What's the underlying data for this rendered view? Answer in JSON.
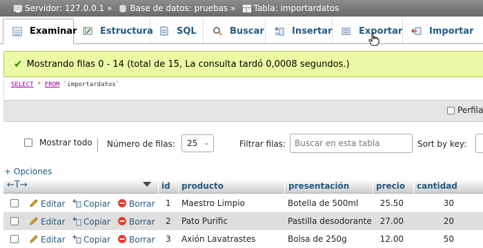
{
  "breadcrumb": {
    "server": "Servidor: 127.0.0.1",
    "database": "Base de datos: pruebas",
    "table": "Tabla: importardatos",
    "separator": "»"
  },
  "tabs": [
    {
      "label": "Examinar",
      "icon": "browse-icon",
      "active": true
    },
    {
      "label": "Estructura",
      "icon": "structure-icon"
    },
    {
      "label": "SQL",
      "icon": "sql-icon"
    },
    {
      "label": "Buscar",
      "icon": "search-icon"
    },
    {
      "label": "Insertar",
      "icon": "insert-icon"
    },
    {
      "label": "Exportar",
      "icon": "export-icon"
    },
    {
      "label": "Importar",
      "icon": "import-icon"
    }
  ],
  "message": {
    "text": "Mostrando filas 0 - 14 (total de 15, La consulta tardó 0,0008 segundos.)"
  },
  "sql": {
    "select": "SELECT",
    "star": "*",
    "from": "FROM",
    "table": "`importardatos`"
  },
  "profiling": {
    "label": "Perfilando"
  },
  "navigation": {
    "show_all": "Mostrar todo",
    "rows_label": "Número de filas:",
    "rows_value": "25",
    "filter_label": "Filtrar filas:",
    "filter_placeholder": "Buscar en esta tabla",
    "sort_label": "Sort by key:"
  },
  "options_link": "+ Opciones",
  "table": {
    "columns": [
      "id",
      "producto",
      "presentación",
      "precio",
      "cantidad"
    ],
    "actions": {
      "edit": "Editar",
      "copy": "Copiar",
      "delete": "Borrar"
    },
    "rows": [
      {
        "id": "1",
        "producto": "Maestro Limpio",
        "presentacion": "Botella de 500ml",
        "precio": "25.50",
        "cantidad": "30"
      },
      {
        "id": "2",
        "producto": "Pato Purific",
        "presentacion": "Pastilla desodorante",
        "precio": "27.00",
        "cantidad": "20"
      },
      {
        "id": "3",
        "producto": "Axión Lavatrastes",
        "presentacion": "Bolsa de 250g",
        "precio": "12.00",
        "cantidad": "50"
      }
    ]
  },
  "colors": {
    "accent": "#235a81",
    "success_bg": "#ebf8a4",
    "success_border": "#a2d246"
  }
}
